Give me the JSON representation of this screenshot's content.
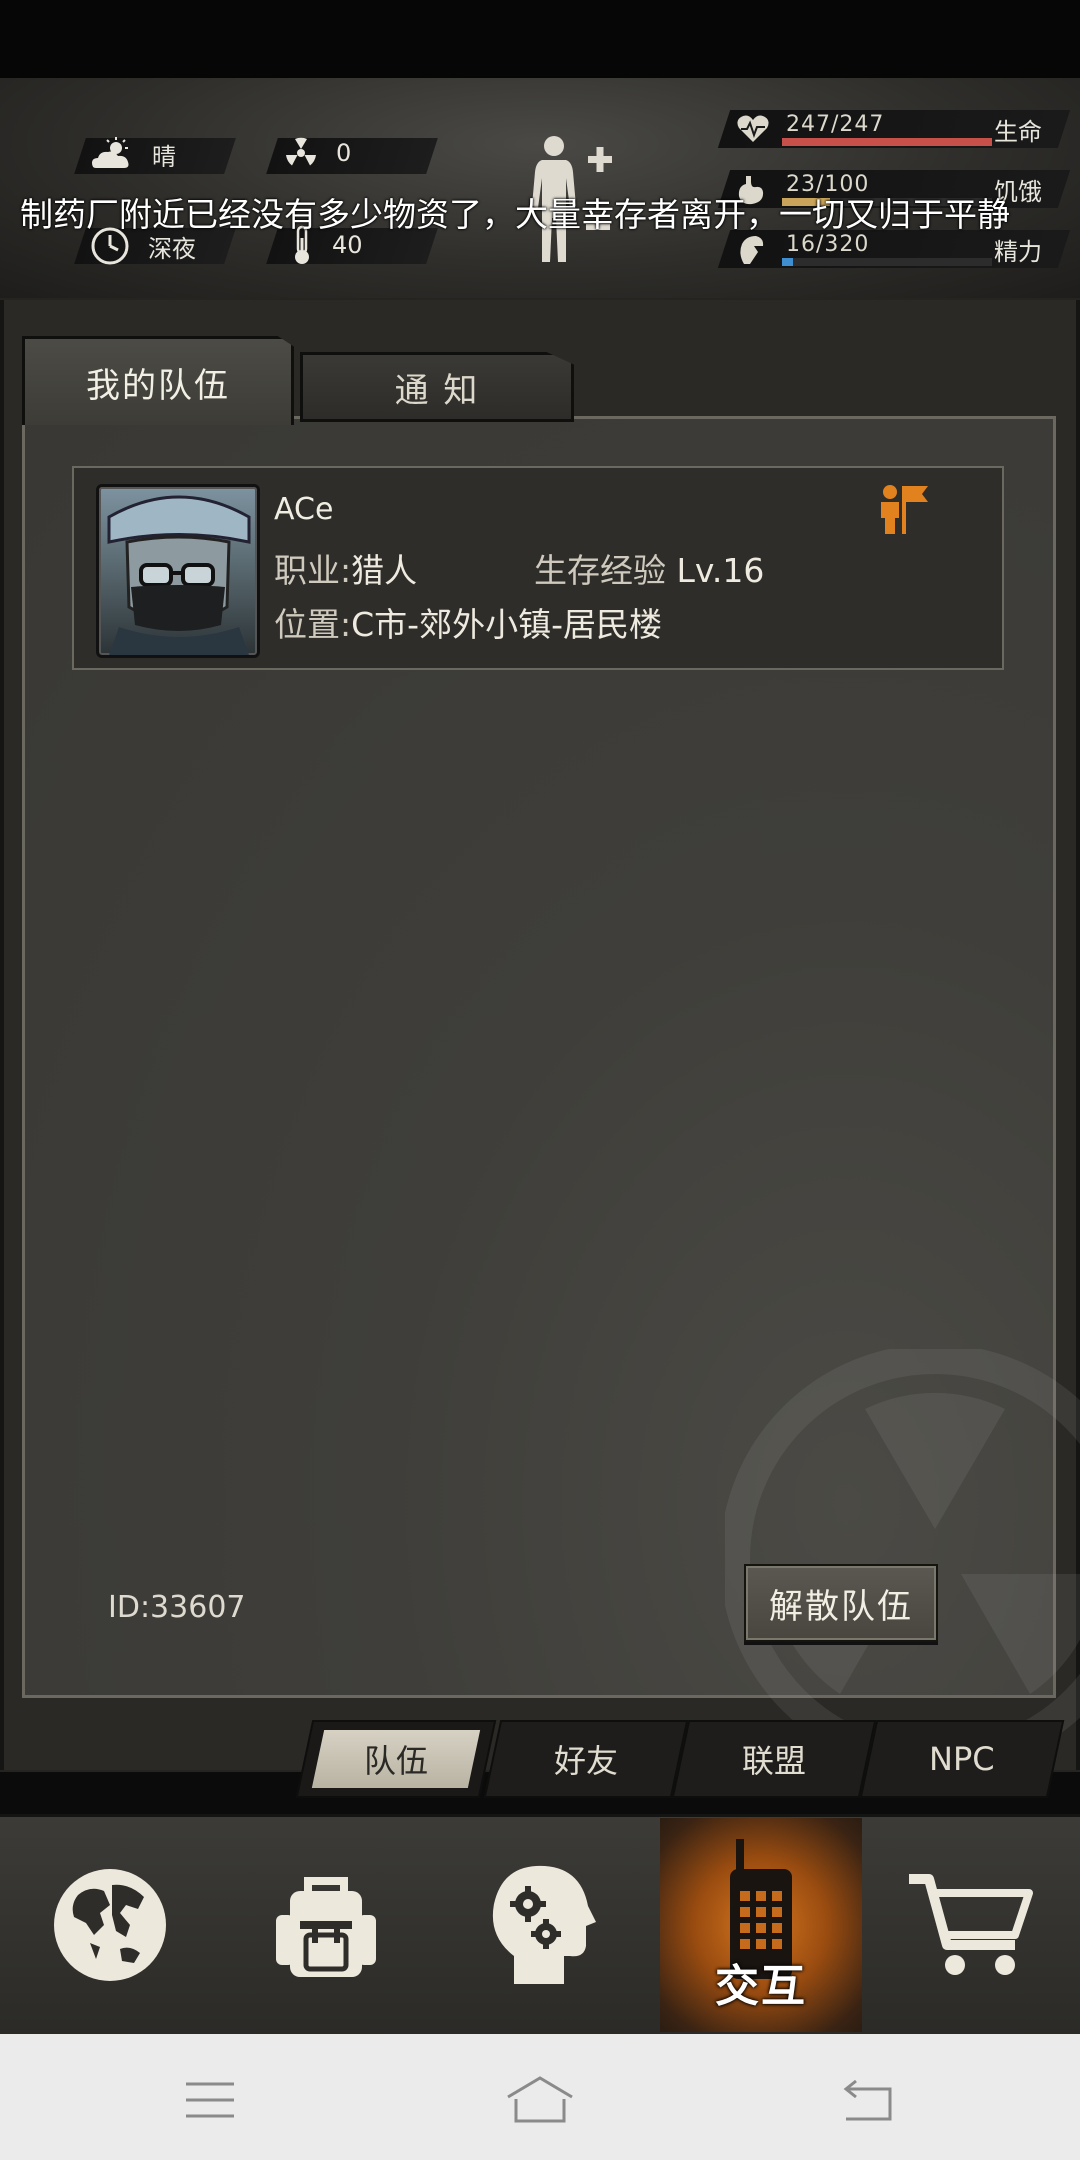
{
  "hud": {
    "weather_label": "晴",
    "radiation_value": "0",
    "time_label": "深夜",
    "temperature_value": "40",
    "ticker": "制药厂附近已经没有多少物资了，大量幸存者离开，一切又归于平静",
    "vitals": [
      {
        "name": "生命",
        "value": "247/247",
        "fill": 1.0,
        "color": "#c8504a"
      },
      {
        "name": "饥饿",
        "value": "23/100",
        "fill": 0.23,
        "color": "#c9a45a"
      },
      {
        "name": "精力",
        "value": "16/320",
        "fill": 0.05,
        "color": "#3f8ed0"
      }
    ]
  },
  "tabs": {
    "my_team": "我的队伍",
    "notice": "通  知"
  },
  "member": {
    "name": "ACe",
    "job_label": "职业:",
    "job_value": "猎人",
    "exp_label": "生存经验",
    "exp_value": "Lv.16",
    "loc_label": "位置:",
    "loc_value": "C市-郊外小镇-居民楼"
  },
  "team_id": "ID:33607",
  "disband_label": "解散队伍",
  "subtabs": [
    "队伍",
    "好友",
    "联盟",
    "NPC"
  ],
  "nav": {
    "interact_label": "交互"
  }
}
